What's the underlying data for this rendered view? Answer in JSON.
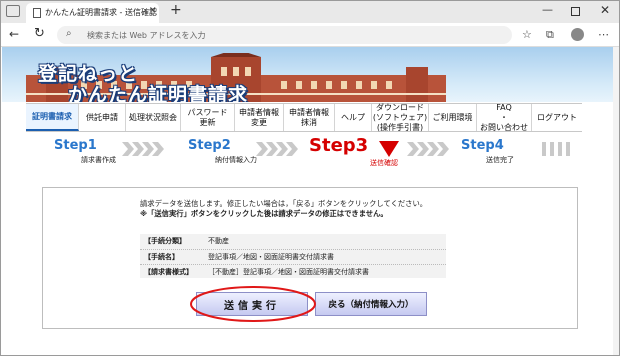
{
  "browser": {
    "tab_title": "かんたん証明書請求 - 送信確認",
    "tab_close": "✕",
    "new_tab": "+",
    "address_placeholder": "検索または Web アドレスを入力",
    "window_minimize": "—",
    "window_close": "✕"
  },
  "banner": {
    "line1": "登記ねっと",
    "line2": "かんたん証明書請求"
  },
  "menu": {
    "items": [
      {
        "label": "証明書請求",
        "active": true
      },
      {
        "label": "供託申請"
      },
      {
        "label": "処理状況照会"
      },
      {
        "label": "パスワード\n更新"
      },
      {
        "label": "申請者情報\n変更"
      },
      {
        "label": "申請者情報\n抹消"
      },
      {
        "label": "ヘルプ"
      },
      {
        "label": "ダウンロード\n(ソフトウェア)\n(操作手引書)"
      },
      {
        "label": "ご利用環境"
      },
      {
        "label": "FAQ\n・\nお問い合わせ"
      },
      {
        "label": "ログアウト"
      }
    ]
  },
  "steps": [
    {
      "title": "Step1",
      "sub": "請求書作成"
    },
    {
      "title": "Step2",
      "sub": "納付情報入力"
    },
    {
      "title": "Step3",
      "sub": "送信確認",
      "current": true
    },
    {
      "title": "Step4",
      "sub": "送信完了"
    }
  ],
  "confirm": {
    "message1": "請求データを送信します。修正したい場合は，「戻る」ボタンをクリックしてください。",
    "message2": "※「送信実行」ボタンをクリックした後は請求データの修正はできません。",
    "rows": [
      {
        "label": "【手続分類】",
        "value": "不動産"
      },
      {
        "label": "【手続名】",
        "value": "登記事項／地図・図面証明書交付請求書"
      },
      {
        "label": "【請求書様式】",
        "value": "［不動産］登記事項／地図・図面証明書交付請求書"
      }
    ],
    "submit_label": "送信実行",
    "back_label": "戻る（納付情報入力）"
  },
  "colors": {
    "accent": "#2a77cc",
    "current_step": "#d50000",
    "highlight": "#e01818"
  }
}
